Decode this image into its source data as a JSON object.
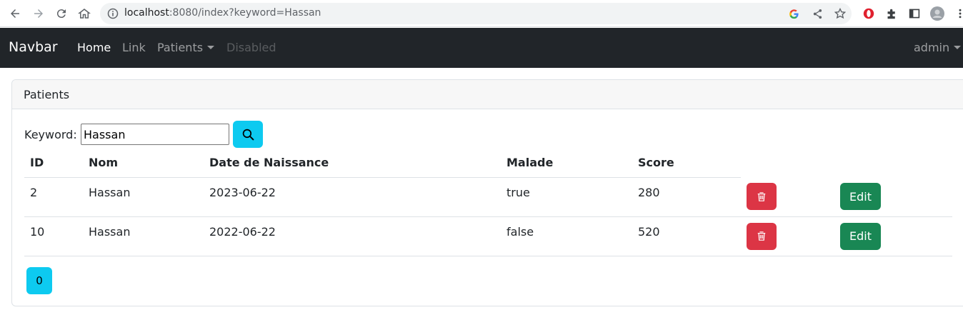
{
  "browser": {
    "url_host": "localhost",
    "url_rest": ":8080/index?keyword=Hassan"
  },
  "navbar": {
    "brand": "Navbar",
    "links": [
      {
        "label": "Home",
        "state": "active"
      },
      {
        "label": "Link",
        "state": "normal"
      },
      {
        "label": "Patients",
        "state": "dropdown"
      },
      {
        "label": "Disabled",
        "state": "disabled"
      }
    ],
    "user": "admin"
  },
  "card": {
    "title": "Patients",
    "search": {
      "label": "Keyword:",
      "value": "Hassan"
    },
    "table": {
      "headers": [
        "ID",
        "Nom",
        "Date de Naissance",
        "Malade",
        "Score"
      ],
      "rows": [
        {
          "id": "2",
          "nom": "Hassan",
          "date": "2023-06-22",
          "malade": "true",
          "score": "280"
        },
        {
          "id": "10",
          "nom": "Hassan",
          "date": "2022-06-22",
          "malade": "false",
          "score": "520"
        }
      ],
      "edit_label": "Edit"
    },
    "pagination": {
      "pages": [
        "0"
      ]
    }
  },
  "colors": {
    "navbar_bg": "#212529",
    "info": "#0dcaf0",
    "danger": "#dc3545",
    "success": "#198754"
  },
  "icons": [
    "back-arrow-icon",
    "forward-arrow-icon",
    "reload-icon",
    "home-icon",
    "info-icon",
    "google-icon",
    "share-icon",
    "star-icon",
    "opera-icon",
    "puzzle-icon",
    "sidepanel-icon",
    "profile-avatar",
    "menu-dots-icon",
    "search-icon",
    "trash-icon"
  ]
}
